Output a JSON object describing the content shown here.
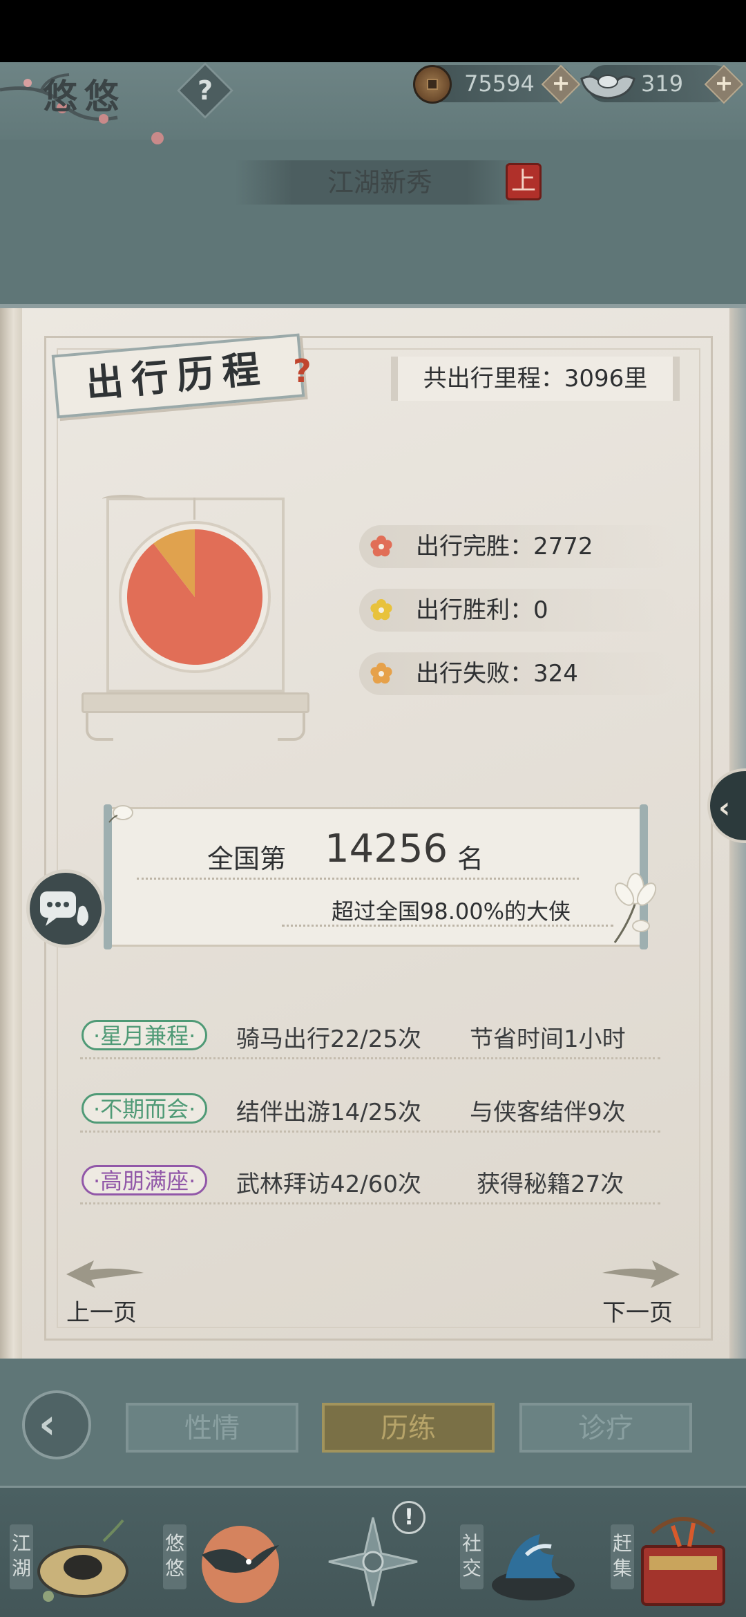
{
  "header": {
    "player_name": "悠悠",
    "help_label": "?",
    "copper": {
      "value": "75594",
      "plus_label": "+"
    },
    "silver": {
      "value": "319",
      "plus_label": "+"
    },
    "rank_title": "江湖新秀",
    "up_badge": "上"
  },
  "book": {
    "section_title": "出行历程",
    "section_help": "?",
    "total_mileage": "共出行里程：3096里",
    "stats": [
      {
        "label": "出行完胜：2772",
        "color": "#e16e57"
      },
      {
        "label": "出行胜利：0",
        "color": "#e8c23c"
      },
      {
        "label": "出行失败：324",
        "color": "#e6a14a"
      }
    ],
    "ranking": {
      "prefix": "全国第",
      "number": "14256",
      "suffix": "名",
      "subtitle": "超过全国98.00%的大侠"
    },
    "achievements": [
      {
        "tag": "·星月兼程·",
        "tag_color": "#4f9a76",
        "progress": "骑马出行22/25次",
        "reward": "节省时间1小时"
      },
      {
        "tag": "·不期而会·",
        "tag_color": "#4f9a76",
        "progress": "结伴出游14/25次",
        "reward": "与侠客结伴9次"
      },
      {
        "tag": "·高朋满座·",
        "tag_color": "#9157a8",
        "progress": "武林拜访42/60次",
        "reward": "获得秘籍27次"
      }
    ],
    "prev_label": "上一页",
    "next_label": "下一页"
  },
  "tabs": [
    {
      "label": "性情",
      "active": false
    },
    {
      "label": "历练",
      "active": true
    },
    {
      "label": "诊疗",
      "active": false
    }
  ],
  "bottom_nav": [
    {
      "label": "江湖"
    },
    {
      "label": "悠悠"
    },
    {
      "label": ""
    },
    {
      "label": "社交"
    },
    {
      "label": "赶集"
    }
  ],
  "nav_alert": "!",
  "chart_data": {
    "type": "pie",
    "values": [
      2772,
      0,
      324
    ],
    "categories": [
      "出行完胜",
      "出行胜利",
      "出行失败"
    ],
    "colors": [
      "#e16e57",
      "#e8c23c",
      "#e0a24e"
    ]
  }
}
